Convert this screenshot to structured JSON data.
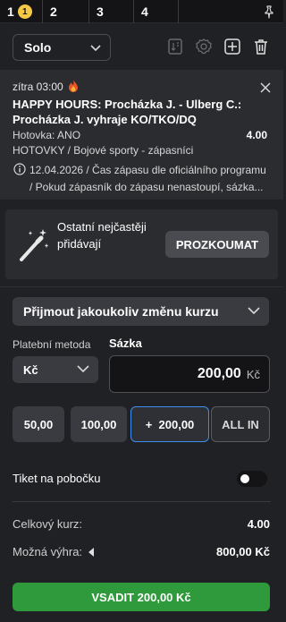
{
  "tabs": [
    {
      "label": "1",
      "badge": "1"
    },
    {
      "label": "2"
    },
    {
      "label": "3"
    },
    {
      "label": "4"
    }
  ],
  "toolbar": {
    "mode": "Solo",
    "icons": [
      "odds-sort-icon",
      "settings-icon",
      "share-icon",
      "trash-icon"
    ]
  },
  "bet": {
    "time": "zítra 03:00",
    "title": "HAPPY HOURS: Procházka J. - Ulberg C.: Procházka J. vyhraje KO/TKO/DQ",
    "selection": "Hotovka: ANO",
    "odds": "4.00",
    "category": "HOTOVKY / Bojové sporty - zápasníci",
    "info": "12.04.2026 / Čas zápasu dle oficiálního programu / Pokud zápasník do zápasu nenastoupí, sázka..."
  },
  "promo": {
    "text": "Ostatní nejčastěji přidávají",
    "button": "PROZKOUMAT"
  },
  "odds_change": "Přijmout jakoukoliv změnu kurzu",
  "payment": {
    "label": "Platební metoda",
    "value": "Kč"
  },
  "stake": {
    "label": "Sázka",
    "value": "200,00",
    "currency": "Kč"
  },
  "quick": {
    "b1": "50,00",
    "b2": "100,00",
    "b3": "+  200,00",
    "b4": "ALL IN"
  },
  "branch_ticket": "Tiket na pobočku",
  "summary": {
    "total_odds_label": "Celkový kurz:",
    "total_odds": "4.00",
    "win_label": "Možná výhra:",
    "win": "800,00 Kč"
  },
  "submit": "VSADIT 200,00 Kč",
  "colors": {
    "background": "#202124",
    "card": "#2b2c30",
    "accent_green": "#2f9a3c",
    "accent_blue": "#3f8ef0",
    "badge_yellow": "#f6c945"
  }
}
